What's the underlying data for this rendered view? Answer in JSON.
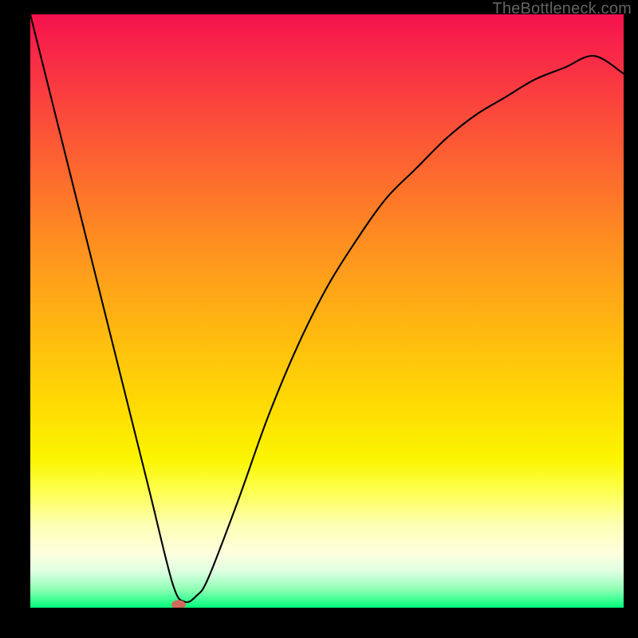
{
  "watermark": "TheBottleneck.com",
  "chart_data": {
    "type": "line",
    "title": "",
    "xlabel": "",
    "ylabel": "",
    "xlim": [
      0,
      1
    ],
    "ylim": [
      0,
      1
    ],
    "grid": false,
    "legend": false,
    "series": [
      {
        "name": "curve",
        "color": "#000000",
        "x": [
          0.0,
          0.05,
          0.1,
          0.15,
          0.2,
          0.24,
          0.26,
          0.28,
          0.3,
          0.35,
          0.4,
          0.45,
          0.5,
          0.55,
          0.6,
          0.65,
          0.7,
          0.75,
          0.8,
          0.85,
          0.9,
          0.95,
          1.0
        ],
        "y": [
          1.0,
          0.8,
          0.6,
          0.4,
          0.2,
          0.04,
          0.01,
          0.02,
          0.05,
          0.18,
          0.32,
          0.44,
          0.54,
          0.62,
          0.69,
          0.74,
          0.79,
          0.83,
          0.86,
          0.89,
          0.91,
          0.93,
          0.9
        ]
      }
    ],
    "marker": {
      "x": 0.25,
      "y": 0.005,
      "color": "#d06a5b",
      "rx": 0.012,
      "ry": 0.008
    }
  }
}
